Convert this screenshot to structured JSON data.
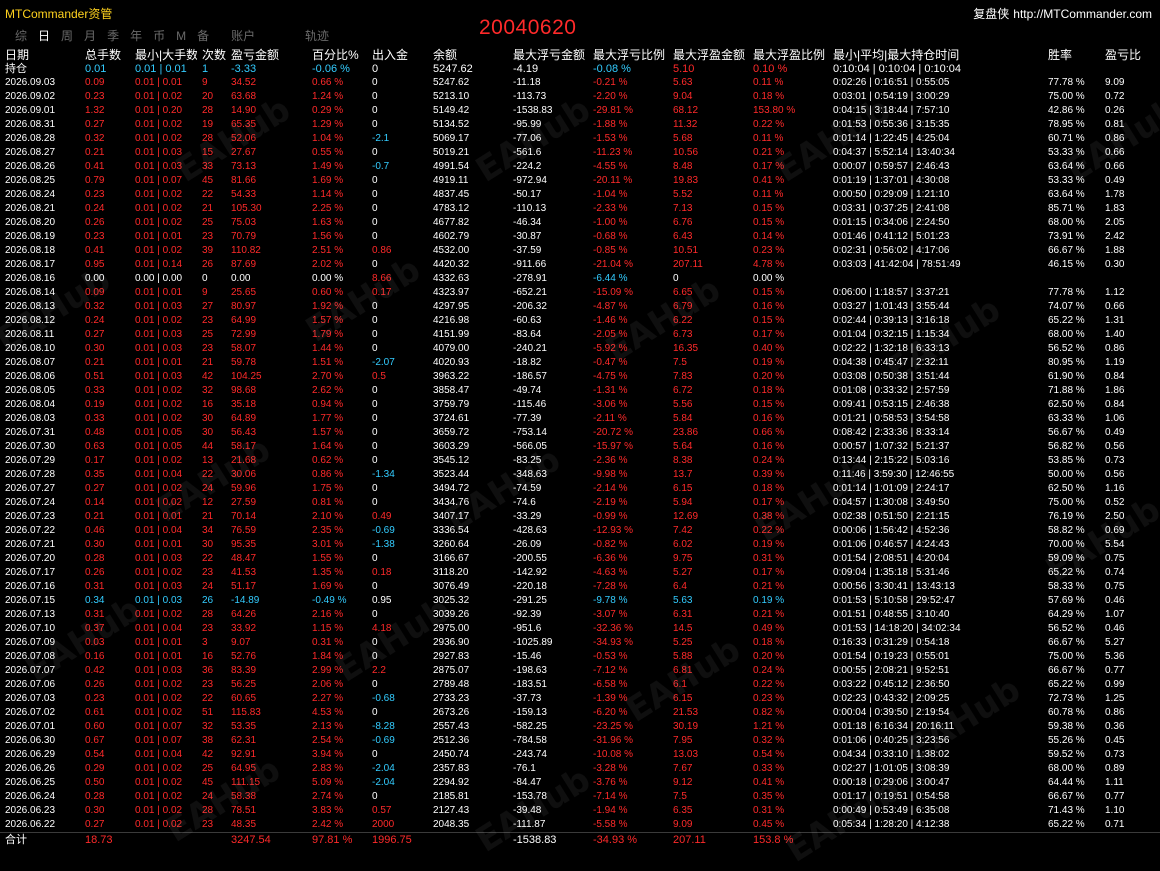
{
  "header": {
    "brand": "MTCommander资管",
    "account_id": "20040620",
    "right_label": "复盘侠",
    "right_url": "http://MTCommander.com",
    "tabs": [
      "综",
      "日",
      "周",
      "月",
      "季",
      "年",
      "币",
      "M",
      "备",
      "账户"
    ],
    "active_tab_index": 1,
    "orbit_label": "轨迹"
  },
  "watermark": "EAHub",
  "columns": [
    "日期",
    "总手数",
    "最小|大手数",
    "次数",
    "盈亏金额",
    "百分比%",
    "出入金",
    "余额",
    "最大浮亏金额",
    "最大浮亏比例",
    "最大浮盈金额",
    "最大浮盈比例",
    "最小|平均|最大持仓时间",
    "胜率",
    "盈亏比"
  ],
  "hold_row": [
    "持仓",
    "0.01",
    "0.01 | 0.01",
    "1",
    "-3.33",
    "-0.06 %",
    "0",
    "5247.62",
    "-4.19",
    "-0.08 %",
    "5.10",
    "0.10 %",
    "0:10:04 | 0:10:04 | 0:10:04",
    "",
    ""
  ],
  "hold_colors": [
    "w",
    "c",
    "c",
    "c",
    "c",
    "c",
    "w",
    "w",
    "w",
    "c",
    "r",
    "r",
    "w",
    "w",
    "w"
  ],
  "rows": [
    [
      "2026.09.03",
      "0.09",
      "0.01 | 0.01",
      "9",
      "34.52",
      "0.66 %",
      "0",
      "5247.62",
      "-11.18",
      "-0.21 %",
      "5.63",
      "0.11 %",
      "0:02:26 | 0:16:51 | 0:55:05",
      "77.78 %",
      "9.09"
    ],
    [
      "2026.09.02",
      "0.23",
      "0.01 | 0.02",
      "20",
      "63.68",
      "1.24 %",
      "0",
      "5213.10",
      "-113.73",
      "-2.20 %",
      "9.04",
      "0.18 %",
      "0:03:01 | 0:54:19 | 3:00:29",
      "75.00 %",
      "0.72"
    ],
    [
      "2026.09.01",
      "1.32",
      "0.01 | 0.20",
      "28",
      "14.90",
      "0.29 %",
      "0",
      "5149.42",
      "-1538.83",
      "-29.81 %",
      "68.12",
      "153.80 %",
      "0:04:15 | 3:18:44 | 7:57:10",
      "42.86 %",
      "0.26"
    ],
    [
      "2026.08.31",
      "0.27",
      "0.01 | 0.02",
      "19",
      "65.35",
      "1.29 %",
      "0",
      "5134.52",
      "-95.99",
      "-1.88 %",
      "11.32",
      "0.22 %",
      "0:01:53 | 0:55:36 | 3:15:35",
      "78.95 %",
      "0.81"
    ],
    [
      "2026.08.28",
      "0.32",
      "0.01 | 0.02",
      "28",
      "52.06",
      "1.04 %",
      "-2.1",
      "5069.17",
      "-77.06",
      "-1.53 %",
      "5.68",
      "0.11 %",
      "0:01:14 | 1:22:45 | 4:25:04",
      "60.71 %",
      "0.86"
    ],
    [
      "2026.08.27",
      "0.21",
      "0.01 | 0.03",
      "15",
      "27.67",
      "0.55 %",
      "0",
      "5019.21",
      "-561.6",
      "-11.23 %",
      "10.56",
      "0.21 %",
      "0:04:37 | 5:52:14 | 13:40:34",
      "53.33 %",
      "0.66"
    ],
    [
      "2026.08.26",
      "0.41",
      "0.01 | 0.03",
      "33",
      "73.13",
      "1.49 %",
      "-0.7",
      "4991.54",
      "-224.2",
      "-4.55 %",
      "8.48",
      "0.17 %",
      "0:00:07 | 0:59:57 | 2:46:43",
      "63.64 %",
      "0.66"
    ],
    [
      "2026.08.25",
      "0.79",
      "0.01 | 0.07",
      "45",
      "81.66",
      "1.69 %",
      "0",
      "4919.11",
      "-972.94",
      "-20.11 %",
      "19.83",
      "0.41 %",
      "0:01:19 | 1:37:01 | 4:30:08",
      "53.33 %",
      "0.49"
    ],
    [
      "2026.08.24",
      "0.23",
      "0.01 | 0.02",
      "22",
      "54.33",
      "1.14 %",
      "0",
      "4837.45",
      "-50.17",
      "-1.04 %",
      "5.52",
      "0.11 %",
      "0:00:50 | 0:29:09 | 1:21:10",
      "63.64 %",
      "1.78"
    ],
    [
      "2026.08.21",
      "0.24",
      "0.01 | 0.02",
      "21",
      "105.30",
      "2.25 %",
      "0",
      "4783.12",
      "-110.13",
      "-2.33 %",
      "7.13",
      "0.15 %",
      "0:03:31 | 0:37:25 | 2:41:08",
      "85.71 %",
      "1.83"
    ],
    [
      "2026.08.20",
      "0.26",
      "0.01 | 0.02",
      "25",
      "75.03",
      "1.63 %",
      "0",
      "4677.82",
      "-46.34",
      "-1.00 %",
      "6.76",
      "0.15 %",
      "0:01:15 | 0:34:06 | 2:24:50",
      "68.00 %",
      "2.05"
    ],
    [
      "2026.08.19",
      "0.23",
      "0.01 | 0.01",
      "23",
      "70.79",
      "1.56 %",
      "0",
      "4602.79",
      "-30.87",
      "-0.68 %",
      "6.43",
      "0.14 %",
      "0:01:46 | 0:41:12 | 5:01:23",
      "73.91 %",
      "2.42"
    ],
    [
      "2026.08.18",
      "0.41",
      "0.01 | 0.02",
      "39",
      "110.82",
      "2.51 %",
      "0.86",
      "4532.00",
      "-37.59",
      "-0.85 %",
      "10.51",
      "0.23 %",
      "0:02:31 | 0:56:02 | 4:17:06",
      "66.67 %",
      "1.88"
    ],
    [
      "2026.08.17",
      "0.95",
      "0.01 | 0.14",
      "26",
      "87.69",
      "2.02 %",
      "0",
      "4420.32",
      "-911.66",
      "-21.04 %",
      "207.11",
      "4.78 %",
      "0:03:03 | 41:42:04 | 78:51:49",
      "46.15 %",
      "0.30"
    ],
    [
      "2026.08.16",
      "0.00",
      "0.00 | 0.00",
      "0",
      "0.00",
      "0.00 %",
      "8.66",
      "4332.63",
      "-278.91",
      "-6.44 %",
      "0",
      "0.00 %",
      "",
      "",
      ""
    ],
    [
      "2026.08.14",
      "0.09",
      "0.01 | 0.01",
      "9",
      "25.65",
      "0.60 %",
      "0.17",
      "4323.97",
      "-652.21",
      "-15.09 %",
      "6.65",
      "0.15 %",
      "0:06:00 | 1:18:57 | 3:37:21",
      "77.78 %",
      "1.12"
    ],
    [
      "2026.08.13",
      "0.32",
      "0.01 | 0.03",
      "27",
      "80.97",
      "1.92 %",
      "0",
      "4297.95",
      "-206.32",
      "-4.87 %",
      "6.79",
      "0.16 %",
      "0:03:27 | 1:01:43 | 3:55:44",
      "74.07 %",
      "0.66"
    ],
    [
      "2026.08.12",
      "0.24",
      "0.01 | 0.02",
      "23",
      "64.99",
      "1.57 %",
      "0",
      "4216.98",
      "-60.63",
      "-1.46 %",
      "6.22",
      "0.15 %",
      "0:02:44 | 0:39:13 | 3:16:18",
      "65.22 %",
      "1.31"
    ],
    [
      "2026.08.11",
      "0.27",
      "0.01 | 0.03",
      "25",
      "72.99",
      "1.79 %",
      "0",
      "4151.99",
      "-83.64",
      "-2.05 %",
      "6.73",
      "0.17 %",
      "0:01:04 | 0:32:15 | 1:15:34",
      "68.00 %",
      "1.40"
    ],
    [
      "2026.08.10",
      "0.30",
      "0.01 | 0.03",
      "23",
      "58.07",
      "1.44 %",
      "0",
      "4079.00",
      "-240.21",
      "-5.92 %",
      "16.35",
      "0.40 %",
      "0:02:22 | 1:32:18 | 6:33:13",
      "56.52 %",
      "0.86"
    ],
    [
      "2026.08.07",
      "0.21",
      "0.01 | 0.01",
      "21",
      "59.78",
      "1.51 %",
      "-2.07",
      "4020.93",
      "-18.82",
      "-0.47 %",
      "7.5",
      "0.19 %",
      "0:04:38 | 0:45:47 | 2:32:11",
      "80.95 %",
      "1.19"
    ],
    [
      "2026.08.06",
      "0.51",
      "0.01 | 0.03",
      "42",
      "104.25",
      "2.70 %",
      "0.5",
      "3963.22",
      "-186.57",
      "-4.75 %",
      "7.83",
      "0.20 %",
      "0:03:08 | 0:50:38 | 3:51:44",
      "61.90 %",
      "0.84"
    ],
    [
      "2026.08.05",
      "0.33",
      "0.01 | 0.02",
      "32",
      "98.68",
      "2.62 %",
      "0",
      "3858.47",
      "-49.74",
      "-1.31 %",
      "6.72",
      "0.18 %",
      "0:01:08 | 0:33:32 | 2:57:59",
      "71.88 %",
      "1.86"
    ],
    [
      "2026.08.04",
      "0.19",
      "0.01 | 0.02",
      "16",
      "35.18",
      "0.94 %",
      "0",
      "3759.79",
      "-115.46",
      "-3.06 %",
      "5.56",
      "0.15 %",
      "0:09:41 | 0:53:15 | 2:46:38",
      "62.50 %",
      "0.84"
    ],
    [
      "2026.08.03",
      "0.33",
      "0.01 | 0.02",
      "30",
      "64.89",
      "1.77 %",
      "0",
      "3724.61",
      "-77.39",
      "-2.11 %",
      "5.84",
      "0.16 %",
      "0:01:21 | 0:58:53 | 3:54:58",
      "63.33 %",
      "1.06"
    ],
    [
      "2026.07.31",
      "0.48",
      "0.01 | 0.05",
      "30",
      "56.43",
      "1.57 %",
      "0",
      "3659.72",
      "-753.14",
      "-20.72 %",
      "23.86",
      "0.66 %",
      "0:08:42 | 2:33:36 | 8:33:14",
      "56.67 %",
      "0.49"
    ],
    [
      "2026.07.30",
      "0.63",
      "0.01 | 0.05",
      "44",
      "58.17",
      "1.64 %",
      "0",
      "3603.29",
      "-566.05",
      "-15.97 %",
      "5.64",
      "0.16 %",
      "0:00:57 | 1:07:32 | 5:21:37",
      "56.82 %",
      "0.56"
    ],
    [
      "2026.07.29",
      "0.17",
      "0.01 | 0.02",
      "13",
      "21.68",
      "0.62 %",
      "0",
      "3545.12",
      "-83.25",
      "-2.36 %",
      "8.38",
      "0.24 %",
      "0:13:44 | 2:15:22 | 5:03:16",
      "53.85 %",
      "0.73"
    ],
    [
      "2026.07.28",
      "0.35",
      "0.01 | 0.04",
      "22",
      "30.06",
      "0.86 %",
      "-1.34",
      "3523.44",
      "-348.63",
      "-9.98 %",
      "13.7",
      "0.39 %",
      "0:11:46 | 3:59:30 | 12:46:55",
      "50.00 %",
      "0.56"
    ],
    [
      "2026.07.27",
      "0.27",
      "0.01 | 0.02",
      "24",
      "59.96",
      "1.75 %",
      "0",
      "3494.72",
      "-74.59",
      "-2.14 %",
      "6.15",
      "0.18 %",
      "0:01:14 | 1:01:09 | 2:24:17",
      "62.50 %",
      "1.16"
    ],
    [
      "2026.07.24",
      "0.14",
      "0.01 | 0.02",
      "12",
      "27.59",
      "0.81 %",
      "0",
      "3434.76",
      "-74.6",
      "-2.19 %",
      "5.94",
      "0.17 %",
      "0:04:57 | 1:30:08 | 3:49:50",
      "75.00 %",
      "0.52"
    ],
    [
      "2026.07.23",
      "0.21",
      "0.01 | 0.01",
      "21",
      "70.14",
      "2.10 %",
      "0.49",
      "3407.17",
      "-33.29",
      "-0.99 %",
      "12.69",
      "0.38 %",
      "0:02:38 | 0:51:50 | 2:21:15",
      "76.19 %",
      "2.50"
    ],
    [
      "2026.07.22",
      "0.46",
      "0.01 | 0.04",
      "34",
      "76.59",
      "2.35 %",
      "-0.69",
      "3336.54",
      "-428.63",
      "-12.93 %",
      "7.42",
      "0.22 %",
      "0:00:06 | 1:56:42 | 4:52:36",
      "58.82 %",
      "0.69"
    ],
    [
      "2026.07.21",
      "0.30",
      "0.01 | 0.01",
      "30",
      "95.35",
      "3.01 %",
      "-1.38",
      "3260.64",
      "-26.09",
      "-0.82 %",
      "6.02",
      "0.19 %",
      "0:01:06 | 0:46:57 | 4:24:43",
      "70.00 %",
      "5.54"
    ],
    [
      "2026.07.20",
      "0.28",
      "0.01 | 0.03",
      "22",
      "48.47",
      "1.55 %",
      "0",
      "3166.67",
      "-200.55",
      "-6.36 %",
      "9.75",
      "0.31 %",
      "0:01:54 | 2:08:51 | 4:20:04",
      "59.09 %",
      "0.75"
    ],
    [
      "2026.07.17",
      "0.26",
      "0.01 | 0.02",
      "23",
      "41.53",
      "1.35 %",
      "0.18",
      "3118.20",
      "-142.92",
      "-4.63 %",
      "5.27",
      "0.17 %",
      "0:09:04 | 1:35:18 | 5:31:46",
      "65.22 %",
      "0.74"
    ],
    [
      "2026.07.16",
      "0.31",
      "0.01 | 0.03",
      "24",
      "51.17",
      "1.69 %",
      "0",
      "3076.49",
      "-220.18",
      "-7.28 %",
      "6.4",
      "0.21 %",
      "0:00:56 | 3:30:41 | 13:43:13",
      "58.33 %",
      "0.75"
    ],
    [
      "2026.07.15",
      "0.34",
      "0.01 | 0.03",
      "26",
      "-14.89",
      "-0.49 %",
      "0.95",
      "3025.32",
      "-291.25",
      "-9.78 %",
      "5.63",
      "0.19 %",
      "0:01:53 | 5:10:58 | 29:52:47",
      "57.69 %",
      "0.46"
    ],
    [
      "2026.07.13",
      "0.31",
      "0.01 | 0.02",
      "28",
      "64.26",
      "2.16 %",
      "0",
      "3039.26",
      "-92.39",
      "-3.07 %",
      "6.31",
      "0.21 %",
      "0:01:51 | 0:48:55 | 3:10:40",
      "64.29 %",
      "1.07"
    ],
    [
      "2026.07.10",
      "0.37",
      "0.01 | 0.04",
      "23",
      "33.92",
      "1.15 %",
      "4.18",
      "2975.00",
      "-951.6",
      "-32.36 %",
      "14.5",
      "0.49 %",
      "0:01:53 | 14:18:20 | 34:02:34",
      "56.52 %",
      "0.46"
    ],
    [
      "2026.07.09",
      "0.03",
      "0.01 | 0.01",
      "3",
      "9.07",
      "0.31 %",
      "0",
      "2936.90",
      "-1025.89",
      "-34.93 %",
      "5.25",
      "0.18 %",
      "0:16:33 | 0:31:29 | 0:54:18",
      "66.67 %",
      "5.27"
    ],
    [
      "2026.07.08",
      "0.16",
      "0.01 | 0.01",
      "16",
      "52.76",
      "1.84 %",
      "0",
      "2927.83",
      "-15.46",
      "-0.53 %",
      "5.88",
      "0.20 %",
      "0:01:54 | 0:19:23 | 0:55:01",
      "75.00 %",
      "5.36"
    ],
    [
      "2026.07.07",
      "0.42",
      "0.01 | 0.03",
      "36",
      "83.39",
      "2.99 %",
      "2.2",
      "2875.07",
      "-198.63",
      "-7.12 %",
      "6.81",
      "0.24 %",
      "0:00:55 | 2:08:21 | 9:52:51",
      "66.67 %",
      "0.77"
    ],
    [
      "2026.07.06",
      "0.26",
      "0.01 | 0.02",
      "23",
      "56.25",
      "2.06 %",
      "0",
      "2789.48",
      "-183.51",
      "-6.58 %",
      "6.1",
      "0.22 %",
      "0:03:22 | 0:45:12 | 2:36:50",
      "65.22 %",
      "0.99"
    ],
    [
      "2026.07.03",
      "0.23",
      "0.01 | 0.02",
      "22",
      "60.65",
      "2.27 %",
      "-0.68",
      "2733.23",
      "-37.73",
      "-1.39 %",
      "6.15",
      "0.23 %",
      "0:02:23 | 0:43:32 | 2:09:25",
      "72.73 %",
      "1.25"
    ],
    [
      "2026.07.02",
      "0.61",
      "0.01 | 0.02",
      "51",
      "115.83",
      "4.53 %",
      "0",
      "2673.26",
      "-159.13",
      "-6.20 %",
      "21.53",
      "0.82 %",
      "0:00:04 | 0:39:50 | 2:19:54",
      "60.78 %",
      "0.86"
    ],
    [
      "2026.07.01",
      "0.60",
      "0.01 | 0.07",
      "32",
      "53.35",
      "2.13 %",
      "-8.28",
      "2557.43",
      "-582.25",
      "-23.25 %",
      "30.19",
      "1.21 %",
      "0:01:18 | 6:16:34 | 20:16:11",
      "59.38 %",
      "0.36"
    ],
    [
      "2026.06.30",
      "0.67",
      "0.01 | 0.07",
      "38",
      "62.31",
      "2.54 %",
      "-0.69",
      "2512.36",
      "-784.58",
      "-31.96 %",
      "7.95",
      "0.32 %",
      "0:01:06 | 0:40:25 | 3:23:56",
      "55.26 %",
      "0.45"
    ],
    [
      "2026.06.29",
      "0.54",
      "0.01 | 0.04",
      "42",
      "92.91",
      "3.94 %",
      "0",
      "2450.74",
      "-243.74",
      "-10.08 %",
      "13.03",
      "0.54 %",
      "0:04:34 | 0:33:10 | 1:38:02",
      "59.52 %",
      "0.73"
    ],
    [
      "2026.06.26",
      "0.29",
      "0.01 | 0.02",
      "25",
      "64.95",
      "2.83 %",
      "-2.04",
      "2357.83",
      "-76.1",
      "-3.28 %",
      "7.67",
      "0.33 %",
      "0:02:27 | 1:01:05 | 3:08:39",
      "68.00 %",
      "0.89"
    ],
    [
      "2026.06.25",
      "0.50",
      "0.01 | 0.02",
      "45",
      "111.15",
      "5.09 %",
      "-2.04",
      "2294.92",
      "-84.47",
      "-3.76 %",
      "9.12",
      "0.41 %",
      "0:00:18 | 0:29:06 | 3:00:47",
      "64.44 %",
      "1.11"
    ],
    [
      "2026.06.24",
      "0.28",
      "0.01 | 0.02",
      "24",
      "58.38",
      "2.74 %",
      "0",
      "2185.81",
      "-153.78",
      "-7.14 %",
      "7.5",
      "0.35 %",
      "0:01:17 | 0:19:51 | 0:54:58",
      "66.67 %",
      "0.77"
    ],
    [
      "2026.06.23",
      "0.30",
      "0.01 | 0.02",
      "28",
      "78.51",
      "3.83 %",
      "0.57",
      "2127.43",
      "-39.48",
      "-1.94 %",
      "6.35",
      "0.31 %",
      "0:00:49 | 0:53:49 | 6:35:08",
      "71.43 %",
      "1.10"
    ],
    [
      "2026.06.22",
      "0.27",
      "0.01 | 0.02",
      "23",
      "48.35",
      "2.42 %",
      "2000",
      "2048.35",
      "-111.87",
      "-5.58 %",
      "9.09",
      "0.45 %",
      "0:05:34 | 1:28:20 | 4:12:38",
      "65.22 %",
      "0.71"
    ]
  ],
  "row_colors": [
    "w",
    "r",
    "r",
    "r",
    "r",
    "r",
    "w",
    "w",
    "w",
    "r",
    "r",
    "r",
    "w",
    "w",
    "w"
  ],
  "cyan_rows": [
    14,
    37
  ],
  "cyan_flow_rows": [
    4,
    6,
    20,
    28,
    32,
    33,
    44,
    46,
    47,
    49,
    50
  ],
  "total_row": [
    "合计",
    "18.73",
    "",
    "",
    "3247.54",
    "97.81 %",
    "1996.75",
    "",
    "-1538.83",
    "-34.93 %",
    "207.11",
    "153.8 %",
    "",
    "",
    ""
  ],
  "total_colors": [
    "w",
    "r",
    "w",
    "w",
    "r",
    "r",
    "r",
    "w",
    "w",
    "r",
    "r",
    "r",
    "w",
    "w",
    "w"
  ],
  "palette": {
    "red": "#ff2a2a",
    "cyan": "#33ccff",
    "white": "#ffffff",
    "yellow": "#ffd21e",
    "bg": "#000000"
  }
}
